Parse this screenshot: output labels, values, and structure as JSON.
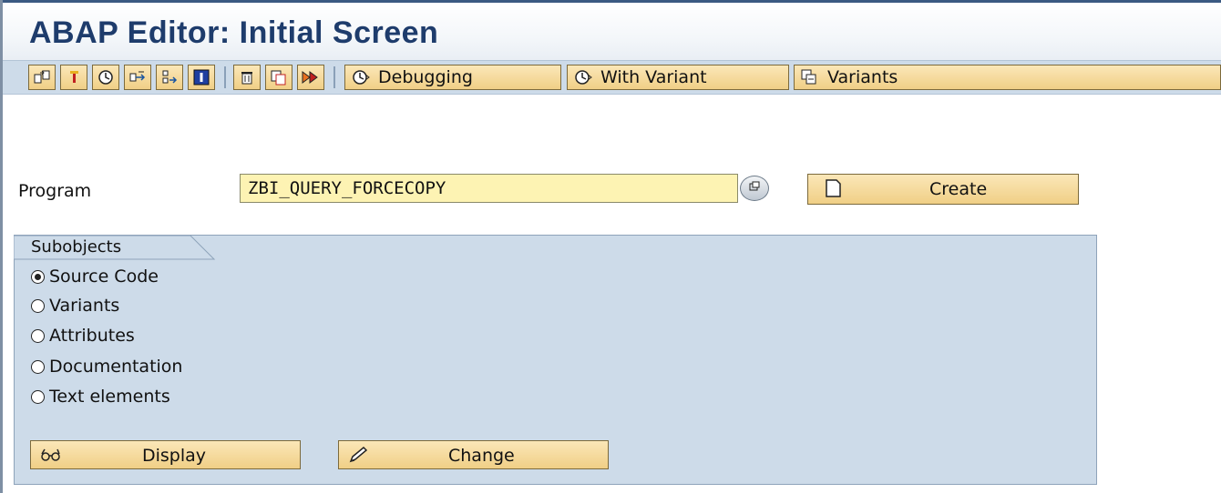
{
  "window": {
    "title": "ABAP Editor: Initial Screen"
  },
  "toolbar": {
    "icon_buttons": [
      {
        "icon": "other-object-icon"
      },
      {
        "icon": "check-icon"
      },
      {
        "icon": "activate-icon"
      },
      {
        "icon": "where-used-icon"
      },
      {
        "icon": "navigate-icon"
      },
      {
        "icon": "info-icon"
      },
      {
        "icon": "delete-icon"
      },
      {
        "icon": "copy-icon"
      },
      {
        "icon": "rename-icon"
      }
    ],
    "debugging_label": "Debugging",
    "with_variant_label": "With Variant",
    "variants_label": "Variants"
  },
  "form": {
    "program_label": "Program",
    "program_value": "ZBI_QUERY_FORCECOPY",
    "create_label": "Create"
  },
  "subobjects": {
    "title": "Subobjects",
    "options": [
      {
        "label": "Source Code",
        "selected": true
      },
      {
        "label": "Variants",
        "selected": false
      },
      {
        "label": "Attributes",
        "selected": false
      },
      {
        "label": "Documentation",
        "selected": false
      },
      {
        "label": "Text elements",
        "selected": false
      }
    ],
    "display_label": "Display",
    "change_label": "Change"
  },
  "colors": {
    "title": "#1e3c6c",
    "toolbar_bg": "#cddbe9",
    "button_bg": "#f0cf86",
    "input_bg": "#fdf3b3",
    "group_bg": "#cddbe9"
  }
}
